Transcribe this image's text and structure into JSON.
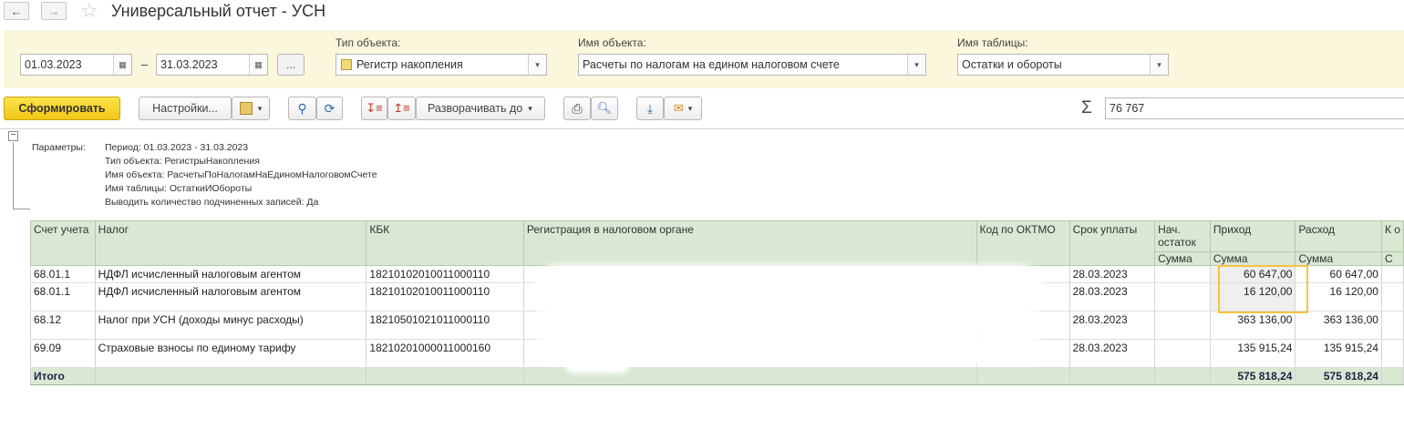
{
  "window": {
    "title": "Универсальный отчет - УСН"
  },
  "nav": {
    "back_icon": "arrow-left-icon",
    "forward_icon": "arrow-right-icon",
    "favorite_icon": "star-icon"
  },
  "filters": {
    "date_from": "01.03.2023",
    "date_dash": "–",
    "date_to": "31.03.2023",
    "dots_label": "...",
    "object_type": {
      "label": "Тип объекта:",
      "value": "Регистр накопления"
    },
    "object_name": {
      "label": "Имя объекта:",
      "value": "Расчеты по налогам на едином налоговом счете"
    },
    "table_name": {
      "label": "Имя таблицы:",
      "value": "Остатки и обороты"
    }
  },
  "toolbar": {
    "generate_label": "Сформировать",
    "settings_label": "Настройки...",
    "expand_label": "Разворачивать до",
    "sum_symbol": "Σ",
    "sum_value": "76 767",
    "accent": "#f2c716"
  },
  "params": {
    "header": "Параметры:",
    "lines": [
      "Период: 01.03.2023 - 31.03.2023",
      "Тип объекта: РегистрыНакопления",
      "Имя объекта: РасчетыПоНалогамНаЕдиномНалоговомСчете",
      "Имя таблицы: ОстаткиИОбороты",
      "Выводить количество подчиненных записей: Да"
    ]
  },
  "table": {
    "headers": {
      "account": "Счет учета",
      "tax": "Налог",
      "kbk": "КБК",
      "registration": "Регистрация в налоговом органе",
      "oktmo": "Код по ОКТМО",
      "due": "Срок уплаты",
      "opening": "Нач. остаток",
      "income": "Приход",
      "expense": "Расход",
      "extra": "К о"
    },
    "subheaders": {
      "opening": "Сумма",
      "income": "Сумма",
      "expense": "Сумма",
      "extra": "С"
    },
    "rows": [
      {
        "account": "68.01.1",
        "tax": "НДФЛ исчисленный налоговым агентом",
        "kbk": "18210102010011000110",
        "due": "28.03.2023",
        "opening": "",
        "income": "60 647,00",
        "expense": "60 647,00"
      },
      {
        "account": "68.01.1",
        "tax": "НДФЛ исчисленный налоговым агентом",
        "kbk": "18210102010011000110",
        "due": "28.03.2023",
        "opening": "",
        "income": "16 120,00",
        "expense": "16 120,00"
      },
      {
        "account": "68.12",
        "tax": "Налог при УСН (доходы минус расходы)",
        "kbk": "18210501021011000110",
        "due": "28.03.2023",
        "opening": "",
        "income": "363 136,00",
        "expense": "363 136,00"
      },
      {
        "account": "69.09",
        "tax": "Страховые взносы по единому тарифу",
        "kbk": "18210201000011000160",
        "due": "28.03.2023",
        "opening": "",
        "income": "135 915,24",
        "expense": "135 915,24"
      }
    ],
    "total": {
      "label": "Итого",
      "income": "575 818,24",
      "expense": "575 818,24"
    }
  }
}
